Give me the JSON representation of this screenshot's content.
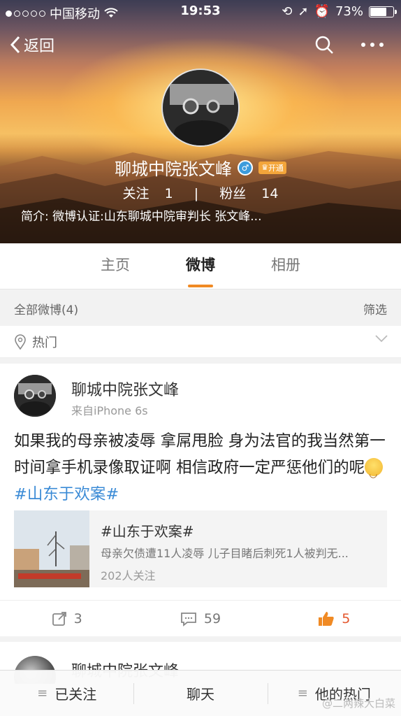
{
  "status_bar": {
    "carrier": "中国移动",
    "time": "19:53",
    "battery_percent": "73%",
    "battery_level": 0.73
  },
  "nav": {
    "back_label": "返回"
  },
  "profile": {
    "name": "聊城中院张文峰",
    "vip_label": "开通",
    "following_label": "关注",
    "following_count": "1",
    "followers_label": "粉丝",
    "followers_count": "14",
    "bio": "简介: 微博认证:山东聊城中院审判长 张文峰..."
  },
  "tabs": [
    {
      "label": "主页",
      "active": false
    },
    {
      "label": "微博",
      "active": true
    },
    {
      "label": "相册",
      "active": false
    }
  ],
  "filter": {
    "all_label": "全部微博(4)",
    "filter_label": "筛选"
  },
  "hot": {
    "label": "热门"
  },
  "post": {
    "author": "聊城中院张文峰",
    "source": "来自iPhone 6s",
    "text": "如果我的母亲被凌辱 拿屌甩脸 身为法官的我当然第一时间拿手机录像取证啊 相信政府一定严惩他们的呢",
    "hashtag": "#山东于欢案#",
    "topic": {
      "title": "#山东于欢案#",
      "description": "母亲欠债遭11人凌辱 儿子目睹后刺死1人被判无...",
      "followers": "202人关注"
    },
    "reposts": "3",
    "comments": "59",
    "likes": "5"
  },
  "post2": {
    "author": "聊城中院张文峰"
  },
  "bottom_bar": {
    "followed_label": "已关注",
    "chat_label": "聊天",
    "hot_label": "他的热门"
  },
  "watermark": "@二两辣大白菜",
  "colors": {
    "accent": "#f08a24",
    "link": "#3b8bd6",
    "like": "#e4572e"
  }
}
